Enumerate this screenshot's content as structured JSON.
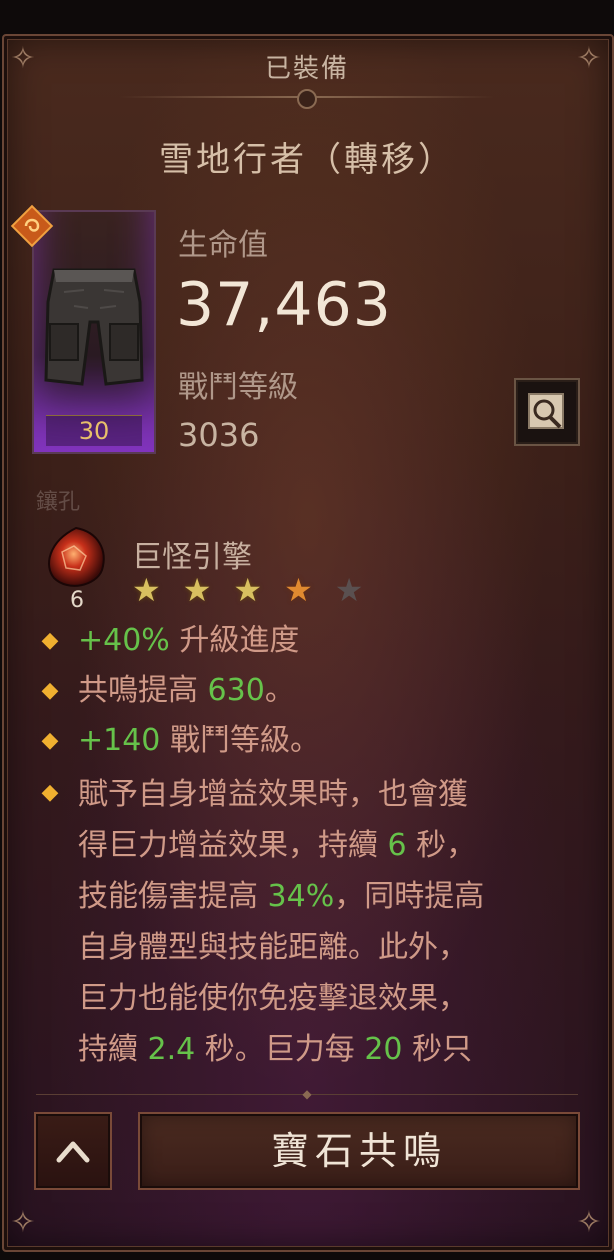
{
  "header": {
    "title": "已裝備"
  },
  "item": {
    "name": "雪地行者（轉移）",
    "level": "30",
    "icon": "pants-icon",
    "badge_icon": "transfer-rune-icon"
  },
  "stats": {
    "life_label": "生命值",
    "life_value": "37,463",
    "power_label": "戰鬥等級",
    "power_value": "3036"
  },
  "sockets": {
    "label": "鑲孔",
    "gem": {
      "name": "巨怪引擎",
      "rank": "6",
      "stars_total": 5,
      "stars_filled": 4
    }
  },
  "affixes": {
    "a1": {
      "num": "+40%",
      "text": " 升級進度"
    },
    "a2": {
      "pre": "共鳴提高 ",
      "num": "630",
      "post": "。"
    },
    "a3": {
      "num": "+140",
      "text": " 戰鬥等級。"
    },
    "a4": {
      "l1": "賦予自身增益效果時，也會獲",
      "l2_pre": "得巨力增益效果，持續 ",
      "l2_num": "6",
      "l2_post": " 秒，",
      "l3_pre": "技能傷害提高 ",
      "l3_num": "34%",
      "l3_post": "，同時提高",
      "l4": "自身體型與技能距離。此外，",
      "l5": "巨力也能使你免疫擊退效果，",
      "l6_pre": "持續 ",
      "l6_num": "2.4",
      "l6_mid": " 秒。巨力每 ",
      "l6_num2": "20",
      "l6_post": " 秒只"
    }
  },
  "buttons": {
    "collapse_icon": "chevron-up-icon",
    "gem_resonance": "寶石共鳴",
    "compare_icon": "magnify-compare-icon"
  }
}
